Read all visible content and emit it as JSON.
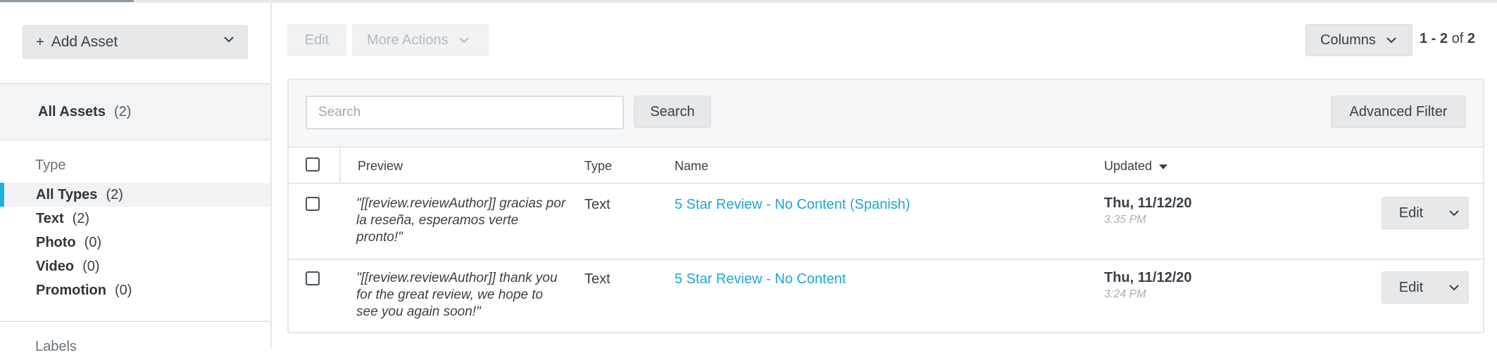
{
  "sidebar": {
    "add_asset": {
      "icon": "plus",
      "label": "Add Asset"
    },
    "all_assets": {
      "label": "All Assets",
      "count": "(2)"
    },
    "type_heading": "Type",
    "types": [
      {
        "label": "All Types",
        "count": "(2)",
        "active": true
      },
      {
        "label": "Text",
        "count": "(2)"
      },
      {
        "label": "Photo",
        "count": "(0)"
      },
      {
        "label": "Video",
        "count": "(0)"
      },
      {
        "label": "Promotion",
        "count": "(0)"
      }
    ],
    "labels_heading": "Labels"
  },
  "toolbar": {
    "edit_label": "Edit",
    "more_actions_label": "More Actions",
    "columns_label": "Columns",
    "pager": {
      "range": "1 - 2",
      "of": "of",
      "total": "2"
    }
  },
  "search": {
    "placeholder": "Search",
    "value": "",
    "button_label": "Search",
    "advanced_filter_label": "Advanced Filter"
  },
  "table": {
    "headers": {
      "preview": "Preview",
      "type": "Type",
      "name": "Name",
      "updated": "Updated"
    },
    "sort": {
      "column": "updated",
      "direction": "desc"
    },
    "rows": [
      {
        "preview": "\"[[review.reviewAuthor]] gracias por la reseña, esperamos verte pronto!\"",
        "type": "Text",
        "name": "5 Star Review - No Content (Spanish)",
        "updated_date": "Thu, 11/12/20",
        "updated_time": "3:35 PM",
        "edit_label": "Edit"
      },
      {
        "preview": "\"[[review.reviewAuthor]] thank you for the great review, we hope to see you again soon!\"",
        "type": "Text",
        "name": "5 Star Review - No Content",
        "updated_date": "Thu, 11/12/20",
        "updated_time": "3:24 PM",
        "edit_label": "Edit"
      }
    ]
  },
  "colors": {
    "accent": "#1fb1de",
    "link": "#1fa6d6",
    "button_bg": "#e6e8ea"
  }
}
